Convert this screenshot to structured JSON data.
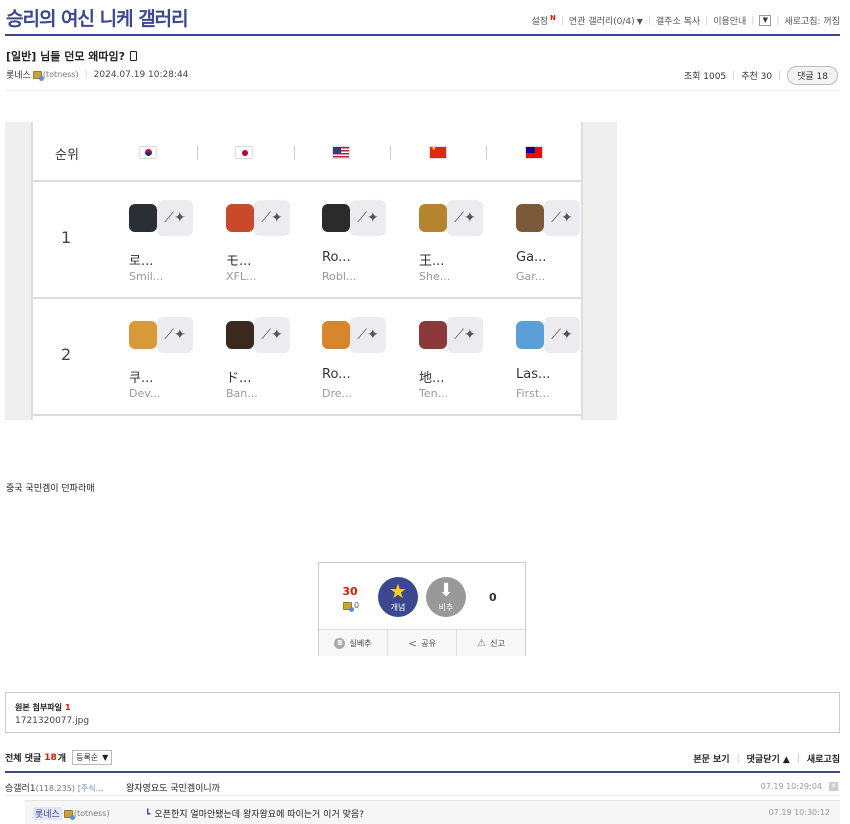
{
  "gallery": {
    "title": "승리의 여신 니케 갤러리"
  },
  "topmenu": {
    "settings": "설정",
    "new_badge": "N",
    "related": "연관 갤러리(0/4)",
    "copy_url": "갤주소 복사",
    "guide": "이용안내",
    "refresh": "새로고침: 꺼짐"
  },
  "post": {
    "title": "[일반] 님들 던모 왜따임?",
    "author": "롯네스",
    "author_id": "(totness)",
    "date": "2024.07.19 10:28:44",
    "views": "조회 1005",
    "recommend": "추천 30",
    "comments_pill": "댓글 18",
    "body": "중국 국민겜이 던파라매"
  },
  "image": {
    "rank_header": "순위",
    "flags": [
      "kr",
      "jp",
      "us",
      "cn",
      "tw"
    ],
    "rows": [
      {
        "rank": "1",
        "apps": [
          {
            "name": "로...",
            "dev": "Smil...",
            "color": "#2a2e35"
          },
          {
            "name": "モ...",
            "dev": "XFL...",
            "color": "#c94a2a"
          },
          {
            "name": "Ro...",
            "dev": "Robl...",
            "color": "#2b2b2b"
          },
          {
            "name": "王...",
            "dev": "She...",
            "color": "#b4842e"
          },
          {
            "name": "Ga...",
            "dev": "Gar...",
            "color": "#7a5a3a"
          }
        ]
      },
      {
        "rank": "2",
        "apps": [
          {
            "name": "쿠...",
            "dev": "Dev...",
            "color": "#d69a3a"
          },
          {
            "name": "ド...",
            "dev": "Ban...",
            "color": "#3a2a1e"
          },
          {
            "name": "Ro...",
            "dev": "Dre...",
            "color": "#d8862e"
          },
          {
            "name": "地...",
            "dev": "Ten...",
            "color": "#8a3a3a"
          },
          {
            "name": "Las...",
            "dev": "First...",
            "color": "#5aa0d8"
          }
        ]
      }
    ]
  },
  "recommend_box": {
    "up_count": "30",
    "fix_count": "0",
    "up_label": "개념",
    "down_label": "비추",
    "down_count": "0",
    "btn_silbechu": "실베추",
    "btn_share": "공유",
    "btn_report": "신고"
  },
  "attachment": {
    "title": "원본 첨부파일",
    "count": "1",
    "file": "1721320077.jpg"
  },
  "comments": {
    "label": "전체 댓글",
    "count": "18",
    "unit": "개",
    "sort": "등록순",
    "view_body": "본문 보기",
    "close": "댓글닫기",
    "refresh": "새로고침",
    "items": [
      {
        "nick": "승갤러1",
        "ip": "(118.235)",
        "mention": "[주식...",
        "text": "왕자영요도 국민겜이니까",
        "date": "07.19 10:29:04"
      }
    ],
    "reply": {
      "nick": "롯네스",
      "uid": "(totness)",
      "text": "오픈한지 얼마안됐는데 왕자왕요에 따이는거 이거 맞음?",
      "date": "07.19 10:30:12"
    }
  }
}
